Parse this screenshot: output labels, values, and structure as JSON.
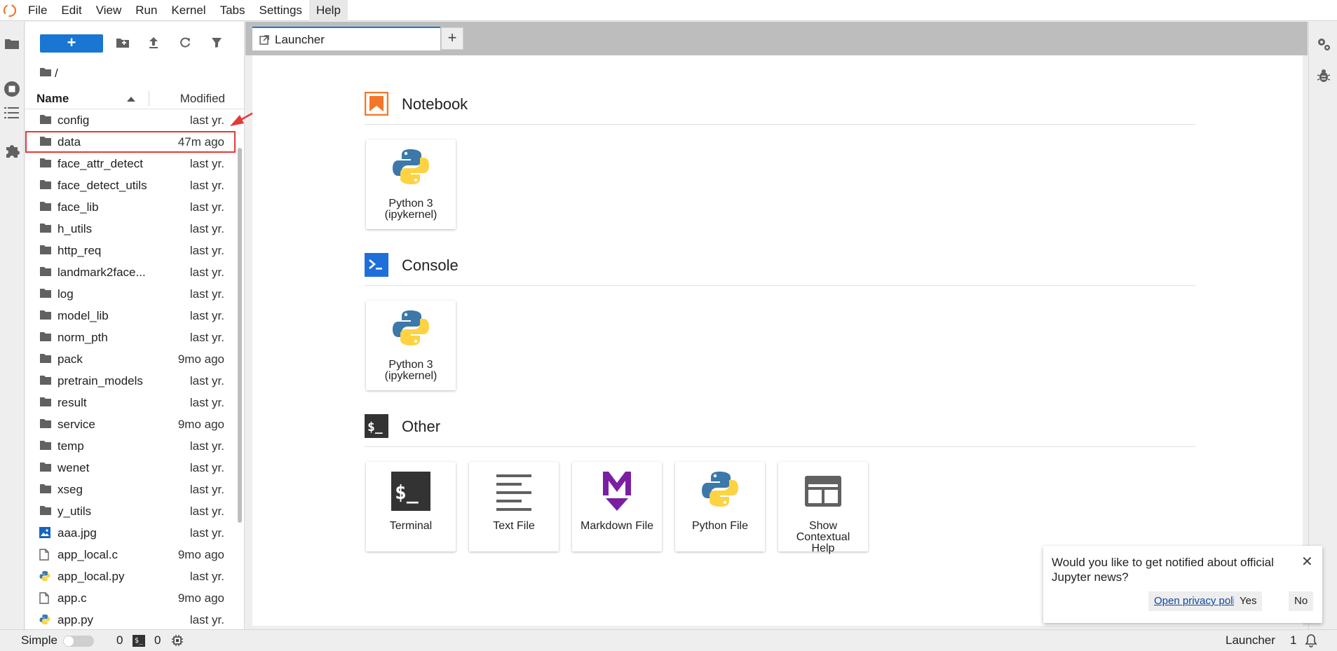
{
  "menubar": {
    "items": [
      "File",
      "Edit",
      "View",
      "Run",
      "Kernel",
      "Tabs",
      "Settings",
      "Help"
    ]
  },
  "filebrowser": {
    "new_label": "+",
    "breadcrumb": "/",
    "columns": {
      "name": "Name",
      "modified": "Modified"
    },
    "rows": [
      {
        "name": "config",
        "modified": "last yr.",
        "type": "folder"
      },
      {
        "name": "data",
        "modified": "47m ago",
        "type": "folder"
      },
      {
        "name": "face_attr_detect",
        "modified": "last yr.",
        "type": "folder"
      },
      {
        "name": "face_detect_utils",
        "modified": "last yr.",
        "type": "folder"
      },
      {
        "name": "face_lib",
        "modified": "last yr.",
        "type": "folder"
      },
      {
        "name": "h_utils",
        "modified": "last yr.",
        "type": "folder"
      },
      {
        "name": "http_req",
        "modified": "last yr.",
        "type": "folder"
      },
      {
        "name": "landmark2face...",
        "modified": "last yr.",
        "type": "folder"
      },
      {
        "name": "log",
        "modified": "last yr.",
        "type": "folder"
      },
      {
        "name": "model_lib",
        "modified": "last yr.",
        "type": "folder"
      },
      {
        "name": "norm_pth",
        "modified": "last yr.",
        "type": "folder"
      },
      {
        "name": "pack",
        "modified": "9mo ago",
        "type": "folder"
      },
      {
        "name": "pretrain_models",
        "modified": "last yr.",
        "type": "folder"
      },
      {
        "name": "result",
        "modified": "last yr.",
        "type": "folder"
      },
      {
        "name": "service",
        "modified": "9mo ago",
        "type": "folder"
      },
      {
        "name": "temp",
        "modified": "last yr.",
        "type": "folder"
      },
      {
        "name": "wenet",
        "modified": "last yr.",
        "type": "folder"
      },
      {
        "name": "xseg",
        "modified": "last yr.",
        "type": "folder"
      },
      {
        "name": "y_utils",
        "modified": "last yr.",
        "type": "folder"
      },
      {
        "name": "aaa.jpg",
        "modified": "last yr.",
        "type": "image"
      },
      {
        "name": "app_local.c",
        "modified": "9mo ago",
        "type": "file"
      },
      {
        "name": "app_local.py",
        "modified": "last yr.",
        "type": "python"
      },
      {
        "name": "app.c",
        "modified": "9mo ago",
        "type": "file"
      },
      {
        "name": "app.py",
        "modified": "last yr.",
        "type": "python"
      }
    ]
  },
  "tabs": [
    {
      "label": "Launcher"
    }
  ],
  "tab_add": "+",
  "launcher": {
    "sections": {
      "notebook": "Notebook",
      "console": "Console",
      "other": "Other"
    },
    "notebook_cards": [
      {
        "label1": "Python 3",
        "label2": "(ipykernel)"
      }
    ],
    "console_cards": [
      {
        "label1": "Python 3",
        "label2": "(ipykernel)"
      }
    ],
    "other_cards": [
      {
        "label": "Terminal"
      },
      {
        "label": "Text File"
      },
      {
        "label": "Markdown File"
      },
      {
        "label": "Python File"
      },
      {
        "label": "Show Contextual Help"
      }
    ],
    "terminal_glyph": "$_",
    "console_glyph": ">_",
    "markdown_glyph": "M"
  },
  "statusbar": {
    "mode": "Simple",
    "kernels": "0",
    "terminal_badge": "$_",
    "terminals": "0",
    "current": "Launcher",
    "count": "1"
  },
  "toast": {
    "message": "Would you like to get notified about official Jupyter news?",
    "privacy": "Open privacy policy",
    "yes": "Yes",
    "no": "No",
    "close": "✕"
  },
  "colors": {
    "accent": "#1976d2",
    "notebook_orange": "#f37726",
    "console_blue": "#1e6fd9",
    "markdown_purple": "#7b1fa2",
    "highlight_red": "#e53935"
  },
  "highlighted_row": "data"
}
